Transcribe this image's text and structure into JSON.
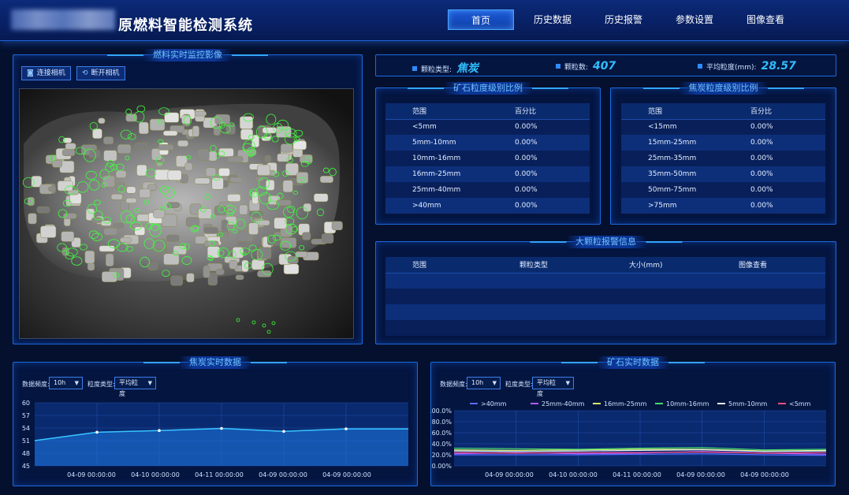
{
  "header": {
    "title": "原燃料智能检测系统",
    "nav": [
      "首页",
      "历史数据",
      "历史报警",
      "参数设置",
      "图像查看"
    ],
    "active": 0
  },
  "camera_panel": {
    "title": "燃料实时监控影像",
    "connect": "连接相机",
    "disconnect": "断开相机"
  },
  "info": {
    "type_label": "颗粒类型:",
    "type_value": "焦炭",
    "count_label": "颗粒数:",
    "count_value": "407",
    "avg_label": "平均粒度(mm):",
    "avg_value": "28.57"
  },
  "ore_table": {
    "title": "矿石粒度级别比例",
    "headers": [
      "范围",
      "百分比"
    ],
    "rows": [
      [
        "<5mm",
        "0.00%"
      ],
      [
        "5mm-10mm",
        "0.00%"
      ],
      [
        "10mm-16mm",
        "0.00%"
      ],
      [
        "16mm-25mm",
        "0.00%"
      ],
      [
        "25mm-40mm",
        "0.00%"
      ],
      [
        ">40mm",
        "0.00%"
      ]
    ]
  },
  "coke_table": {
    "title": "焦炭粒度级别比例",
    "headers": [
      "范围",
      "百分比"
    ],
    "rows": [
      [
        "<15mm",
        "0.00%"
      ],
      [
        "15mm-25mm",
        "0.00%"
      ],
      [
        "25mm-35mm",
        "0.00%"
      ],
      [
        "35mm-50mm",
        "0.00%"
      ],
      [
        "50mm-75mm",
        "0.00%"
      ],
      [
        ">75mm",
        "0.00%"
      ]
    ]
  },
  "alarm_table": {
    "title": "大颗粒报警信息",
    "headers": [
      "范围",
      "颗粒类型",
      "大小(mm)",
      "图像查看"
    ]
  },
  "coke_chart": {
    "title": "焦炭实时数据",
    "freq_label": "数据频度:",
    "freq_value": "10h",
    "ptype_label": "粒度类型:",
    "ptype_value": "平均粒度"
  },
  "ore_chart": {
    "title": "矿石实时数据",
    "freq_label": "数据频度:",
    "freq_value": "10h",
    "ptype_label": "粒度类型:",
    "ptype_value": "平均粒度"
  },
  "colors": {
    "accent": "#2f8cff",
    "line": "#38c6ff"
  },
  "chart_data": [
    {
      "type": "area",
      "categories": [
        "04-09 00:00:00",
        "04-10 00:00:00",
        "04-11 00:00:00",
        "04-09 00:00:00",
        "04-09 00:00:00"
      ],
      "x_points": [
        0,
        1,
        2,
        3,
        4,
        5,
        6
      ],
      "values": [
        51.0,
        53.0,
        53.4,
        53.9,
        53.2,
        53.8,
        53.8
      ],
      "yticks": [
        45,
        48,
        51,
        54,
        57,
        60
      ],
      "ylim": [
        45,
        60
      ]
    },
    {
      "type": "line",
      "categories": [
        "04-09 00:00:00",
        "04-10 00:00:00",
        "04-11 00:00:00",
        "04-09 00:00:00",
        "04-09 00:00:00"
      ],
      "yticks": [
        "0.00%",
        "20.0%",
        "40.0%",
        "60.0%",
        "80.0%",
        "100.0%"
      ],
      "ylim": [
        0,
        100
      ],
      "series": [
        {
          "name": ">40mm",
          "color": "#5a6cff",
          "values": [
            20,
            20,
            20,
            21,
            22,
            20,
            19
          ]
        },
        {
          "name": "25mm-40mm",
          "color": "#b05cff",
          "values": [
            22,
            24,
            22,
            23,
            26,
            23,
            21
          ]
        },
        {
          "name": "16mm-25mm",
          "color": "#d8f06a",
          "values": [
            29,
            28,
            29,
            30,
            30,
            27,
            28
          ]
        },
        {
          "name": "10mm-16mm",
          "color": "#47d86a",
          "values": [
            32,
            31,
            30,
            32,
            33,
            29,
            30
          ]
        },
        {
          "name": "5mm-10mm",
          "color": "#e6eefc",
          "values": [
            27,
            26,
            27,
            28,
            29,
            26,
            27
          ]
        },
        {
          "name": "<5mm",
          "color": "#ff4f7a",
          "values": [
            24,
            23,
            24,
            24,
            25,
            23,
            24
          ]
        }
      ]
    }
  ]
}
